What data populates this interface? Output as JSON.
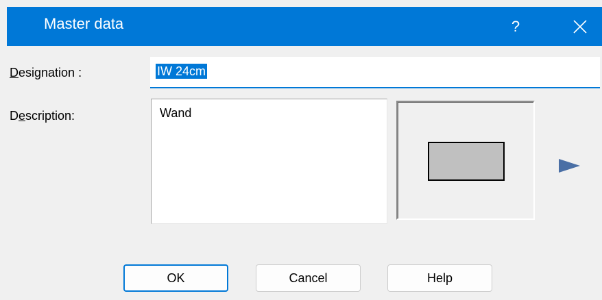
{
  "window": {
    "title": "Master data",
    "help_glyph": "?",
    "close_icon": "close-icon",
    "accent": "#0078d7"
  },
  "form": {
    "designation_label_prefix": "",
    "designation_label_hotkey": "D",
    "designation_label_rest": "esignation :",
    "designation_value": "IW 24cm",
    "description_label_prefix": "D",
    "description_label_hotkey": "e",
    "description_label_rest": "scription:",
    "description_value": "Wand"
  },
  "preview": {
    "expand_icon": "play-arrow-icon"
  },
  "buttons": {
    "ok": "OK",
    "cancel": "Cancel",
    "help": "Help"
  }
}
